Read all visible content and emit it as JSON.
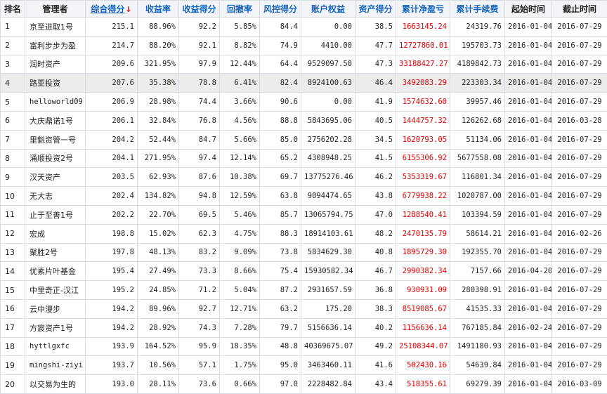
{
  "headers": {
    "rank": "排名",
    "manager": "管理者",
    "total_score": "综合得分",
    "sort_indicator": "↓",
    "return_rate": "收益率",
    "return_score": "收益得分",
    "drawdown": "回撤率",
    "risk_score": "风控得分",
    "equity": "账户权益",
    "asset_score": "资产得分",
    "net_profit": "累计净盈亏",
    "fees": "累计手续费",
    "start_date": "起始时间",
    "end_date": "截止时间"
  },
  "rows": [
    {
      "rank": "1",
      "manager": "京至进取1号",
      "total": "215.1",
      "ret": "88.96%",
      "ret_score": "92.2",
      "dd": "5.85%",
      "risk": "84.4",
      "equity": "0.00",
      "asset": "38.5",
      "profit": "1663145.24",
      "fees": "24319.76",
      "start": "2016-01-04",
      "end": "2016-07-29"
    },
    {
      "rank": "2",
      "manager": "富利步步为盈",
      "total": "214.7",
      "ret": "88.20%",
      "ret_score": "92.1",
      "dd": "8.82%",
      "risk": "74.9",
      "equity": "4410.00",
      "asset": "47.7",
      "profit": "12727860.01",
      "fees": "195703.73",
      "start": "2016-01-04",
      "end": "2016-07-29"
    },
    {
      "rank": "3",
      "manager": "润时资产",
      "total": "209.6",
      "ret": "321.95%",
      "ret_score": "97.9",
      "dd": "12.44%",
      "risk": "64.4",
      "equity": "9529097.50",
      "asset": "47.3",
      "profit": "33188427.27",
      "fees": "4189842.73",
      "start": "2016-01-04",
      "end": "2016-07-29"
    },
    {
      "rank": "4",
      "manager": "路亚投资",
      "total": "207.6",
      "ret": "35.38%",
      "ret_score": "78.8",
      "dd": "6.41%",
      "risk": "82.4",
      "equity": "8924100.63",
      "asset": "46.4",
      "profit": "3492083.29",
      "fees": "223303.34",
      "start": "2016-01-04",
      "end": "2016-07-29"
    },
    {
      "rank": "5",
      "manager": "helloworld09",
      "total": "206.9",
      "ret": "28.98%",
      "ret_score": "74.4",
      "dd": "3.66%",
      "risk": "90.6",
      "equity": "0.00",
      "asset": "41.9",
      "profit": "1574632.60",
      "fees": "39957.46",
      "start": "2016-01-04",
      "end": "2016-07-29"
    },
    {
      "rank": "6",
      "manager": "大庆鼎诺1号",
      "total": "206.1",
      "ret": "32.84%",
      "ret_score": "76.8",
      "dd": "4.56%",
      "risk": "88.8",
      "equity": "5843695.06",
      "asset": "40.5",
      "profit": "1444757.32",
      "fees": "126262.68",
      "start": "2016-01-04",
      "end": "2016-03-28"
    },
    {
      "rank": "7",
      "manager": "里魁资管一号",
      "total": "204.2",
      "ret": "52.44%",
      "ret_score": "84.7",
      "dd": "5.66%",
      "risk": "85.0",
      "equity": "2756202.28",
      "asset": "34.5",
      "profit": "1620793.05",
      "fees": "51134.06",
      "start": "2016-01-04",
      "end": "2016-07-29"
    },
    {
      "rank": "8",
      "manager": "涌顺投资2号",
      "total": "204.1",
      "ret": "271.95%",
      "ret_score": "97.4",
      "dd": "12.14%",
      "risk": "65.2",
      "equity": "4308948.25",
      "asset": "41.5",
      "profit": "6155306.92",
      "fees": "5677558.08",
      "start": "2016-01-04",
      "end": "2016-07-29"
    },
    {
      "rank": "9",
      "manager": "汉天资产",
      "total": "203.5",
      "ret": "62.93%",
      "ret_score": "87.6",
      "dd": "10.38%",
      "risk": "69.7",
      "equity": "13775276.46",
      "asset": "46.2",
      "profit": "5353319.67",
      "fees": "116801.34",
      "start": "2016-01-04",
      "end": "2016-07-29"
    },
    {
      "rank": "10",
      "manager": "无大志",
      "total": "202.4",
      "ret": "134.82%",
      "ret_score": "94.8",
      "dd": "12.59%",
      "risk": "63.8",
      "equity": "9094474.65",
      "asset": "43.8",
      "profit": "6779938.22",
      "fees": "1020787.00",
      "start": "2016-01-04",
      "end": "2016-07-29"
    },
    {
      "rank": "11",
      "manager": "止于至善1号",
      "total": "202.2",
      "ret": "22.70%",
      "ret_score": "69.5",
      "dd": "5.46%",
      "risk": "85.7",
      "equity": "13065794.75",
      "asset": "47.0",
      "profit": "1288540.41",
      "fees": "103394.59",
      "start": "2016-01-04",
      "end": "2016-07-29"
    },
    {
      "rank": "12",
      "manager": "宏成",
      "total": "198.8",
      "ret": "15.02%",
      "ret_score": "62.3",
      "dd": "4.75%",
      "risk": "88.3",
      "equity": "18914103.61",
      "asset": "48.2",
      "profit": "2470135.79",
      "fees": "58614.21",
      "start": "2016-01-04",
      "end": "2016-02-26"
    },
    {
      "rank": "13",
      "manager": "聚胜2号",
      "total": "197.8",
      "ret": "48.13%",
      "ret_score": "83.2",
      "dd": "9.09%",
      "risk": "73.8",
      "equity": "5834629.30",
      "asset": "40.8",
      "profit": "1895729.30",
      "fees": "192355.70",
      "start": "2016-01-04",
      "end": "2016-07-29"
    },
    {
      "rank": "14",
      "manager": "优素片叶基金",
      "total": "195.4",
      "ret": "27.49%",
      "ret_score": "73.3",
      "dd": "8.66%",
      "risk": "75.4",
      "equity": "15930582.34",
      "asset": "46.7",
      "profit": "2990382.34",
      "fees": "7157.66",
      "start": "2016-04-20",
      "end": "2016-07-29"
    },
    {
      "rank": "15",
      "manager": "中里奇正-汉江",
      "total": "195.2",
      "ret": "24.85%",
      "ret_score": "71.2",
      "dd": "5.04%",
      "risk": "87.2",
      "equity": "2931657.59",
      "asset": "36.8",
      "profit": "930931.09",
      "fees": "280398.91",
      "start": "2016-01-04",
      "end": "2016-07-29"
    },
    {
      "rank": "16",
      "manager": "云中漫步",
      "total": "194.2",
      "ret": "89.96%",
      "ret_score": "92.7",
      "dd": "12.71%",
      "risk": "63.2",
      "equity": "175.20",
      "asset": "38.3",
      "profit": "8519085.67",
      "fees": "41535.33",
      "start": "2016-01-04",
      "end": "2016-07-29"
    },
    {
      "rank": "17",
      "manager": "方宸资产1号",
      "total": "194.2",
      "ret": "28.92%",
      "ret_score": "74.3",
      "dd": "7.28%",
      "risk": "79.7",
      "equity": "5156636.14",
      "asset": "40.2",
      "profit": "1156636.14",
      "fees": "767185.84",
      "start": "2016-02-24",
      "end": "2016-07-29"
    },
    {
      "rank": "18",
      "manager": "hyttlgxfc",
      "total": "193.9",
      "ret": "164.52%",
      "ret_score": "95.9",
      "dd": "18.35%",
      "risk": "48.8",
      "equity": "40369675.07",
      "asset": "49.2",
      "profit": "25108344.07",
      "fees": "1491180.93",
      "start": "2016-01-04",
      "end": "2016-07-29"
    },
    {
      "rank": "19",
      "manager": "mingshi-ziyi",
      "total": "193.7",
      "ret": "10.56%",
      "ret_score": "57.1",
      "dd": "1.75%",
      "risk": "95.0",
      "equity": "3463460.11",
      "asset": "41.6",
      "profit": "502430.16",
      "fees": "54639.84",
      "start": "2016-01-04",
      "end": "2016-07-29"
    },
    {
      "rank": "20",
      "manager": "以交易为生的",
      "total": "193.0",
      "ret": "28.11%",
      "ret_score": "73.6",
      "dd": "0.66%",
      "risk": "97.0",
      "equity": "2228482.84",
      "asset": "43.4",
      "profit": "518355.61",
      "fees": "69279.39",
      "start": "2016-01-04",
      "end": "2016-03-09"
    }
  ],
  "highlighted_row": 3,
  "colors": {
    "header_link": "#1565c0",
    "profit_red": "#e00000",
    "sort_arrow": "#dd0000",
    "highlight_bg": "#ececec"
  }
}
